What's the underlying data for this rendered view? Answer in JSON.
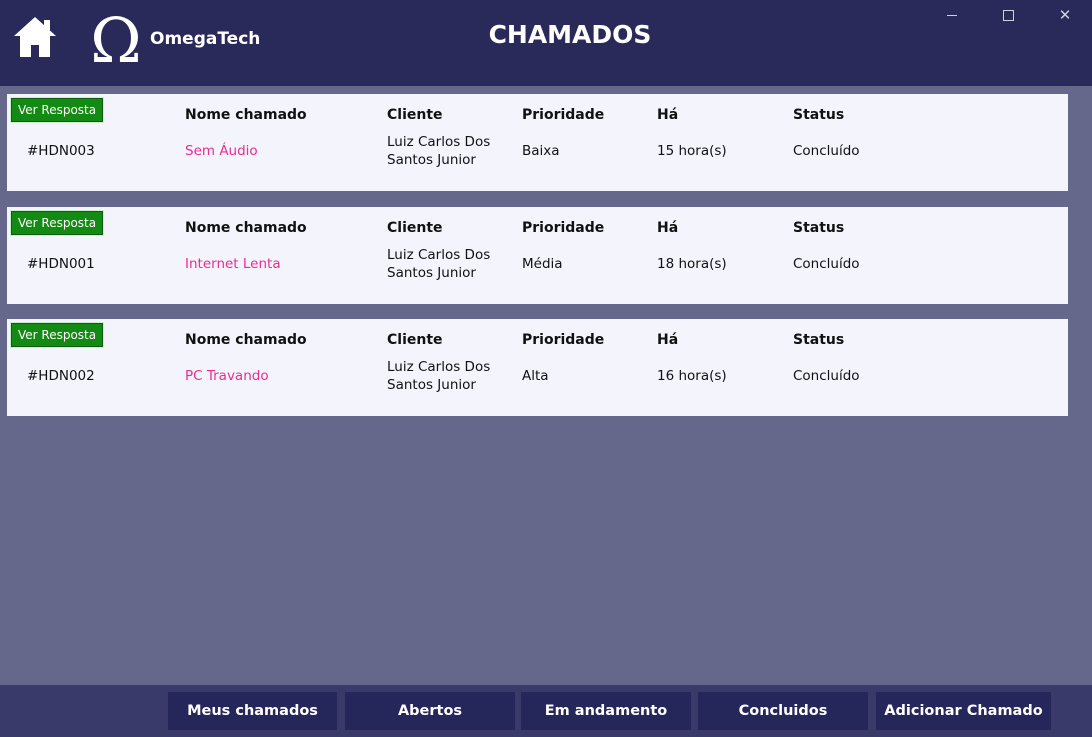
{
  "header": {
    "brand": "OmegaTech",
    "title": "CHAMADOS",
    "icons": {
      "home": "home-icon",
      "logo": "omega-logo-icon"
    },
    "window_controls": {
      "minimize": "minimize-icon",
      "maximize": "maximize-icon",
      "close": "close-icon"
    }
  },
  "columns": {
    "name": "Nome chamado",
    "client": "Cliente",
    "priority": "Prioridade",
    "age": "Há",
    "status": "Status"
  },
  "tickets": [
    {
      "button": "Ver Resposta",
      "code": "#HDN003",
      "name": "Sem Áudio",
      "client_line1": "Luiz Carlos Dos",
      "client_line2": "Santos Junior",
      "priority": "Baixa",
      "age": "15 hora(s)",
      "status": "Concluído"
    },
    {
      "button": "Ver Resposta",
      "code": "#HDN001",
      "name": "Internet Lenta",
      "client_line1": "Luiz Carlos Dos",
      "client_line2": "Santos Junior",
      "priority": "Média",
      "age": "18 hora(s)",
      "status": "Concluído"
    },
    {
      "button": "Ver Resposta",
      "code": "#HDN002",
      "name": "PC Travando",
      "client_line1": "Luiz Carlos Dos",
      "client_line2": "Santos Junior",
      "priority": "Alta",
      "age": "16 hora(s)",
      "status": "Concluído"
    }
  ],
  "footer": {
    "buttons": [
      "Meus chamados",
      "Abertos",
      "Em andamento",
      "Concluidos",
      "Adicionar Chamado"
    ]
  },
  "colors": {
    "header_bg": "#29295a",
    "body_bg": "#65678b",
    "card_bg": "#f4f4fd",
    "accent_pink": "#ea2c93",
    "button_green": "#138a13",
    "footer_bg": "#393a69",
    "footer_button_bg": "#25265a"
  }
}
